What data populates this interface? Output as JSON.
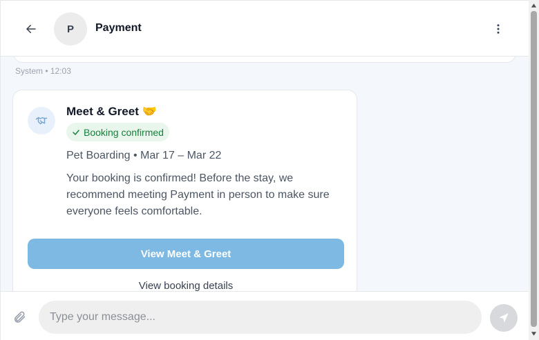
{
  "header": {
    "avatar_initial": "P",
    "title": "Payment"
  },
  "messages": {
    "meta": "System • 12:03",
    "card": {
      "title": "Meet & Greet 🤝",
      "badge": "Booking confirmed",
      "subtitle": "Pet Boarding • Mar 17 – Mar 22",
      "body": "Your booking is confirmed! Before the stay, we recommend meeting Payment in person to make sure everyone feels comfortable.",
      "primary_button": "View Meet & Greet",
      "secondary_button": "View booking details"
    }
  },
  "composer": {
    "placeholder": "Type your message..."
  },
  "icons": {
    "back": "arrow-left-icon",
    "more": "more-vertical-icon",
    "card": "handshake-icon",
    "badge": "check-icon",
    "attach": "paperclip-icon",
    "send": "send-icon"
  },
  "colors": {
    "primary": "#7db9e3",
    "badge_bg": "#e8f6ec",
    "badge_text": "#16803c",
    "send_bg": "#d7d9dc"
  }
}
